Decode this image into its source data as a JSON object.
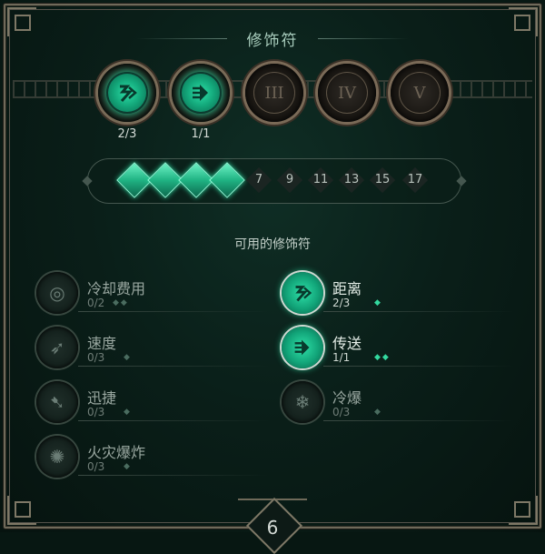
{
  "title": "修饰符",
  "slots": [
    {
      "roman": "",
      "icon": "range-rune-icon",
      "count": "2/3",
      "active": true
    },
    {
      "roman": "",
      "icon": "teleport-rune-icon",
      "count": "1/1",
      "active": true
    },
    {
      "roman": "III",
      "icon": "",
      "count": "",
      "active": false
    },
    {
      "roman": "IV",
      "icon": "",
      "count": "",
      "active": false
    },
    {
      "roman": "V",
      "icon": "",
      "count": "",
      "active": false
    }
  ],
  "level_track": {
    "filled": 4,
    "levels": [
      "7",
      "9",
      "11",
      "13",
      "15",
      "17"
    ]
  },
  "available_label": "可用的修饰符",
  "modifiers_left": [
    {
      "name": "冷却费用",
      "count": "0/2",
      "pips": "◆◆",
      "icon": "cooldown-rune-icon",
      "active": false
    },
    {
      "name": "速度",
      "count": "0/3",
      "pips": "◆",
      "icon": "speed-rune-icon",
      "active": false
    },
    {
      "name": "迅捷",
      "count": "0/3",
      "pips": "◆",
      "icon": "swift-rune-icon",
      "active": false
    },
    {
      "name": "火灾爆炸",
      "count": "0/3",
      "pips": "◆",
      "icon": "fire-burst-rune-icon",
      "active": false
    }
  ],
  "modifiers_right": [
    {
      "name": "距离",
      "count": "2/3",
      "pips": "◆",
      "icon": "range-rune-icon",
      "active": true
    },
    {
      "name": "传送",
      "count": "1/1",
      "pips": "◆◆",
      "icon": "teleport-rune-icon",
      "active": true
    },
    {
      "name": "冷爆",
      "count": "0/3",
      "pips": "◆",
      "icon": "frost-burst-rune-icon",
      "active": false
    }
  ],
  "bottom_tab_label": "6",
  "colors": {
    "accent_green": "#2ee0a8",
    "frame_bronze": "#7a6a57",
    "background": "#0a1f19"
  }
}
